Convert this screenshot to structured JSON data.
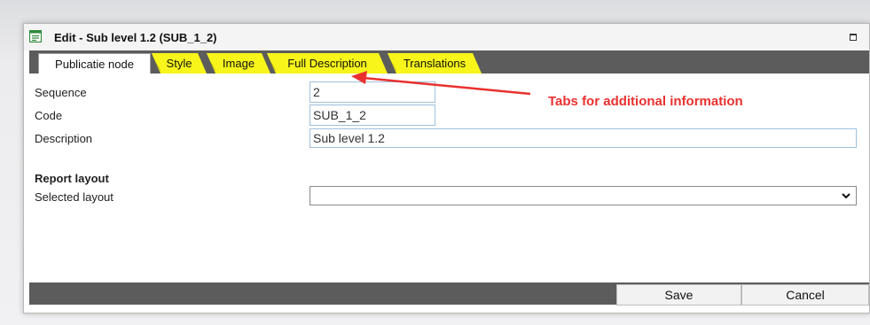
{
  "window": {
    "title": "Edit - Sub level 1.2 (SUB_1_2)"
  },
  "tabs": [
    {
      "label": "Publicatie node",
      "active": true
    },
    {
      "label": "Style",
      "active": false
    },
    {
      "label": "Image",
      "active": false
    },
    {
      "label": "Full Description",
      "active": false
    },
    {
      "label": "Translations",
      "active": false
    }
  ],
  "form": {
    "sequence_label": "Sequence",
    "sequence_value": "2",
    "code_label": "Code",
    "code_value": "SUB_1_2",
    "description_label": "Description",
    "description_value": "Sub level 1.2",
    "report_layout_heading": "Report layout",
    "selected_layout_label": "Selected layout",
    "selected_layout_value": ""
  },
  "annotation": {
    "text": "Tabs for additional information",
    "color": "#e8312f"
  },
  "buttons": {
    "save": "Save",
    "cancel": "Cancel"
  },
  "colors": {
    "tab_yellow": "#f7f51a",
    "bar_gray": "#5c5c5c",
    "field_border": "#9fc0dc"
  }
}
